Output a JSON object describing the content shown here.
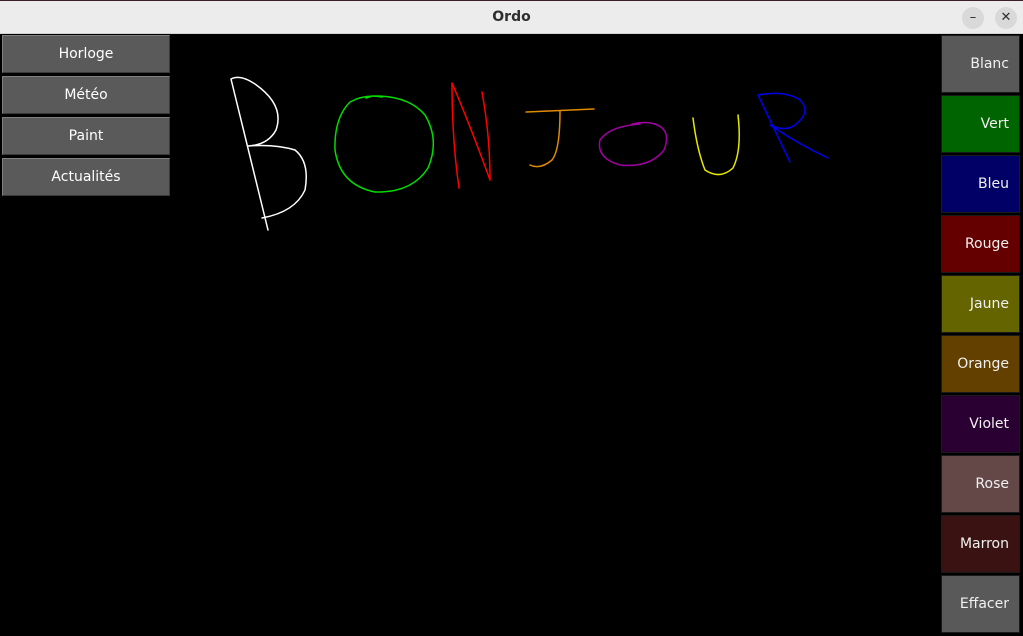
{
  "window": {
    "title": "Ordo",
    "minimize_symbol": "–",
    "close_symbol": "✕"
  },
  "menu": {
    "items": [
      {
        "label": "Horloge"
      },
      {
        "label": "Météo"
      },
      {
        "label": "Paint"
      },
      {
        "label": "Actualités"
      }
    ]
  },
  "palette": {
    "buttons": [
      {
        "label": "Blanc",
        "color": "#595959"
      },
      {
        "label": "Vert",
        "color": "#006400"
      },
      {
        "label": "Bleu",
        "color": "#000066"
      },
      {
        "label": "Rouge",
        "color": "#640000"
      },
      {
        "label": "Jaune",
        "color": "#646400"
      },
      {
        "label": "Orange",
        "color": "#644000"
      },
      {
        "label": "Violet",
        "color": "#2a0033"
      },
      {
        "label": "Rose",
        "color": "#644848"
      },
      {
        "label": "Marron",
        "color": "#3a1212"
      },
      {
        "label": "Effacer",
        "color": "#595959"
      }
    ]
  },
  "drawing": {
    "strokes": [
      {
        "letter": "B",
        "color": "#ffffff"
      },
      {
        "letter": "O",
        "color": "#00dd00"
      },
      {
        "letter": "N",
        "color": "#ff0000"
      },
      {
        "letter": "J",
        "color": "#e08a00"
      },
      {
        "letter": "O",
        "color": "#a000a0"
      },
      {
        "letter": "U",
        "color": "#e8e800"
      },
      {
        "letter": "R",
        "color": "#0000ee"
      }
    ]
  }
}
